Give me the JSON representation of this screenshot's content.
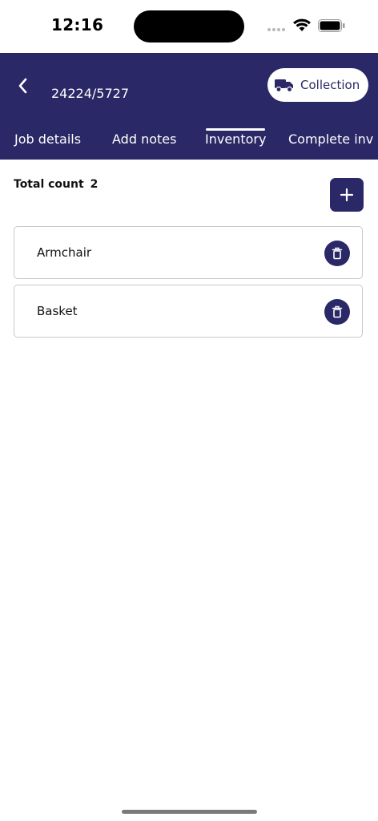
{
  "status_bar": {
    "time": "12:16"
  },
  "header": {
    "job_number": "24224/5727",
    "collection_label": "Collection"
  },
  "tabs": [
    {
      "label": "Job details"
    },
    {
      "label": "Add notes"
    },
    {
      "label": "Inventory",
      "active": true
    },
    {
      "label": "Complete inv"
    }
  ],
  "inventory": {
    "total_label": "Total count",
    "total_count": "2",
    "items": [
      {
        "label": "Armchair"
      },
      {
        "label": "Basket"
      }
    ]
  },
  "colors": {
    "brand": "#2a2866",
    "background": "#ffffff",
    "border": "#c9c9c9"
  },
  "icons": [
    "back-icon",
    "truck-icon",
    "plus-icon",
    "trash-icon",
    "wifi-icon",
    "battery-icon"
  ]
}
